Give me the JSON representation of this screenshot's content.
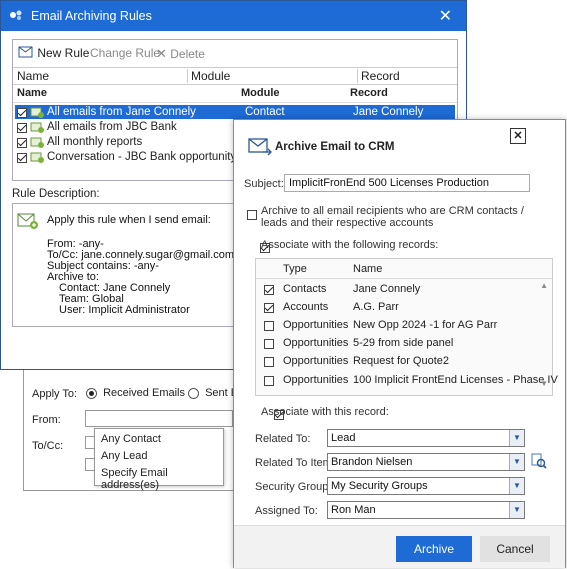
{
  "main_window": {
    "title": "Email Archiving Rules",
    "close_glyph": "✕",
    "toolbar": {
      "new_rule": "New Rule",
      "change_rule": "Change Rule",
      "delete": "Delete"
    },
    "columns_outer": [
      "Name",
      "Module",
      "Record"
    ],
    "columns_inner": [
      "Name",
      "Module",
      "Record"
    ],
    "rules": [
      {
        "name": "All emails from Jane Connely",
        "module": "Contact",
        "record": "Jane Connely",
        "checked": true,
        "selected": true
      },
      {
        "name": "All emails from JBC Bank",
        "module": "",
        "record": "",
        "checked": true,
        "selected": false
      },
      {
        "name": "All monthly reports",
        "module": "",
        "record": "",
        "checked": true,
        "selected": false
      },
      {
        "name": "Conversation - JBC Bank opportunity",
        "module": "",
        "record": "",
        "checked": true,
        "selected": false
      }
    ],
    "rule_description_label": "Rule Description:",
    "description": {
      "apply": "Apply this rule when I send email:",
      "from": "From: -any-",
      "tocc": "To/Cc: jane.connely.sugar@gmail.com",
      "subject": "Subject contains: -any-",
      "archive_to": "Archive to:",
      "contact": "Contact: Jane Connely",
      "team": "Team: Global",
      "user": "User: Implicit Administrator"
    }
  },
  "lower_panel": {
    "apply_to_label": "Apply To:",
    "received": "Received Emails",
    "sent": "Sent E",
    "from_label": "From:",
    "tocc_label": "To/Cc:",
    "from_options": [
      "Any Contact",
      "Any Lead",
      "Specify Email address(es)"
    ]
  },
  "dialog": {
    "title": "Archive Email to CRM",
    "subject_label": "Subject:",
    "subject_value": "ImplicitFronEnd 500 Licenses Production",
    "archive_all_label": "Archive to all email recipients who are CRM contacts / leads and their respective accounts",
    "associate_following_label": "Associate with the following records:",
    "records_header": {
      "type": "Type",
      "name": "Name"
    },
    "records": [
      {
        "type": "Contacts",
        "name": "Jane Connely",
        "checked": true
      },
      {
        "type": "Accounts",
        "name": "A.G. Parr",
        "checked": true
      },
      {
        "type": "Opportunities",
        "name": "New Opp 2024 -1 for AG Parr",
        "checked": false
      },
      {
        "type": "Opportunities",
        "name": "5-29 from side panel",
        "checked": false
      },
      {
        "type": "Opportunities",
        "name": "Request for Quote2",
        "checked": false
      },
      {
        "type": "Opportunities",
        "name": "100 Implicit FrontEnd Licenses - Phase IV",
        "checked": false
      }
    ],
    "associate_this_label": "Associate with this record:",
    "related_to_label": "Related To:",
    "related_to_value": "Lead",
    "related_item_label": "Related To Item:",
    "related_item_value": "Brandon Nielsen",
    "security_group_label": "Security Group:",
    "security_group_value": "My Security Groups",
    "assigned_to_label": "Assigned To:",
    "assigned_to_value": "Ron Man",
    "archive_button": "Archive",
    "cancel_button": "Cancel",
    "close_glyph": "✕"
  },
  "colors": {
    "title_bar": "#1e6bd6",
    "selection": "#1e6bd6",
    "archive_button": "#1e6bd6"
  }
}
